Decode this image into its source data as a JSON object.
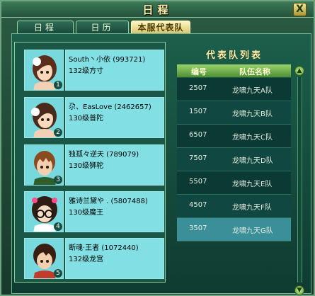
{
  "window": {
    "title": "日程",
    "close_label": "X"
  },
  "tabs": [
    {
      "label": "日程",
      "active": false
    },
    {
      "label": "日历",
      "active": false
    },
    {
      "label": "本服代表队",
      "active": true
    }
  ],
  "members": [
    {
      "name": "South丶小依 (993721)",
      "level_class": "132级方寸",
      "number": "1"
    },
    {
      "name": "尕、EasLove (2462657)",
      "level_class": "130级普陀",
      "number": "2"
    },
    {
      "name": "独孤々逆天 (789079)",
      "level_class": "130级狮驼",
      "number": "3"
    },
    {
      "name": "雅诗兰黛や . (5807488)",
      "level_class": "130级魔王",
      "number": "4"
    },
    {
      "name": "断魂·王者 (1072440)",
      "level_class": "132级龙宫",
      "number": "5"
    }
  ],
  "team_list": {
    "title": "代表队列表",
    "headers": {
      "id": "编号",
      "team_name": "队伍名称"
    },
    "rows": [
      {
        "id": "2507",
        "name": "龙啸九天A队",
        "selected": false
      },
      {
        "id": "1507",
        "name": "龙啸九天B队",
        "selected": false
      },
      {
        "id": "6507",
        "name": "龙啸九天C队",
        "selected": false
      },
      {
        "id": "7507",
        "name": "龙啸九天D队",
        "selected": false
      },
      {
        "id": "5507",
        "name": "龙啸九天E队",
        "selected": false
      },
      {
        "id": "4507",
        "name": "龙啸九天F队",
        "selected": false
      },
      {
        "id": "3507",
        "name": "龙啸九天G队",
        "selected": true
      }
    ]
  },
  "colors": {
    "selected_row": "#3a8f98",
    "avatar_bg": "#77d8de",
    "title_text": "#fff2a8"
  }
}
